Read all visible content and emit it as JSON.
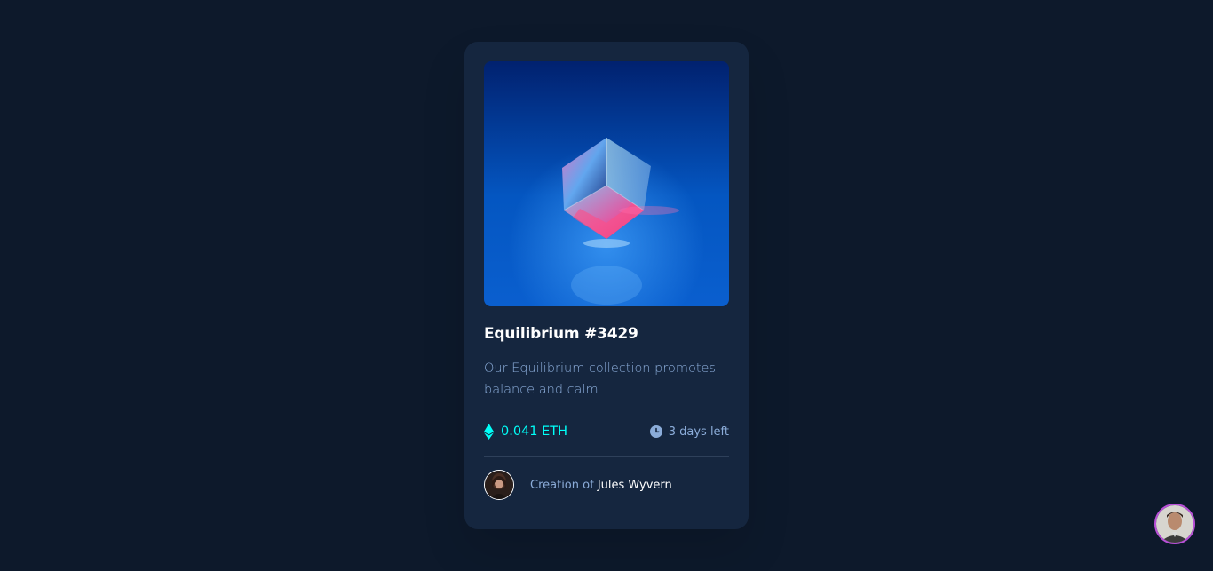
{
  "nft": {
    "image_alt": "Equilibrium crystal cube",
    "title": "Equilibrium #3429",
    "description": "Our Equilibrium collection promotes balance and calm.",
    "price": "0.041 ETH",
    "time_left": "3 days left",
    "creator_prefix": "Creation of",
    "creator_name": "Jules Wyvern"
  },
  "colors": {
    "background": "#0d192b",
    "card": "#15263f",
    "accent_cyan": "#00fff8",
    "soft_blue": "#8bacd9",
    "divider": "#2e405a",
    "corner_avatar_ring": "#b84fd7"
  },
  "icons": {
    "price": "ethereum-icon",
    "time": "clock-icon"
  }
}
